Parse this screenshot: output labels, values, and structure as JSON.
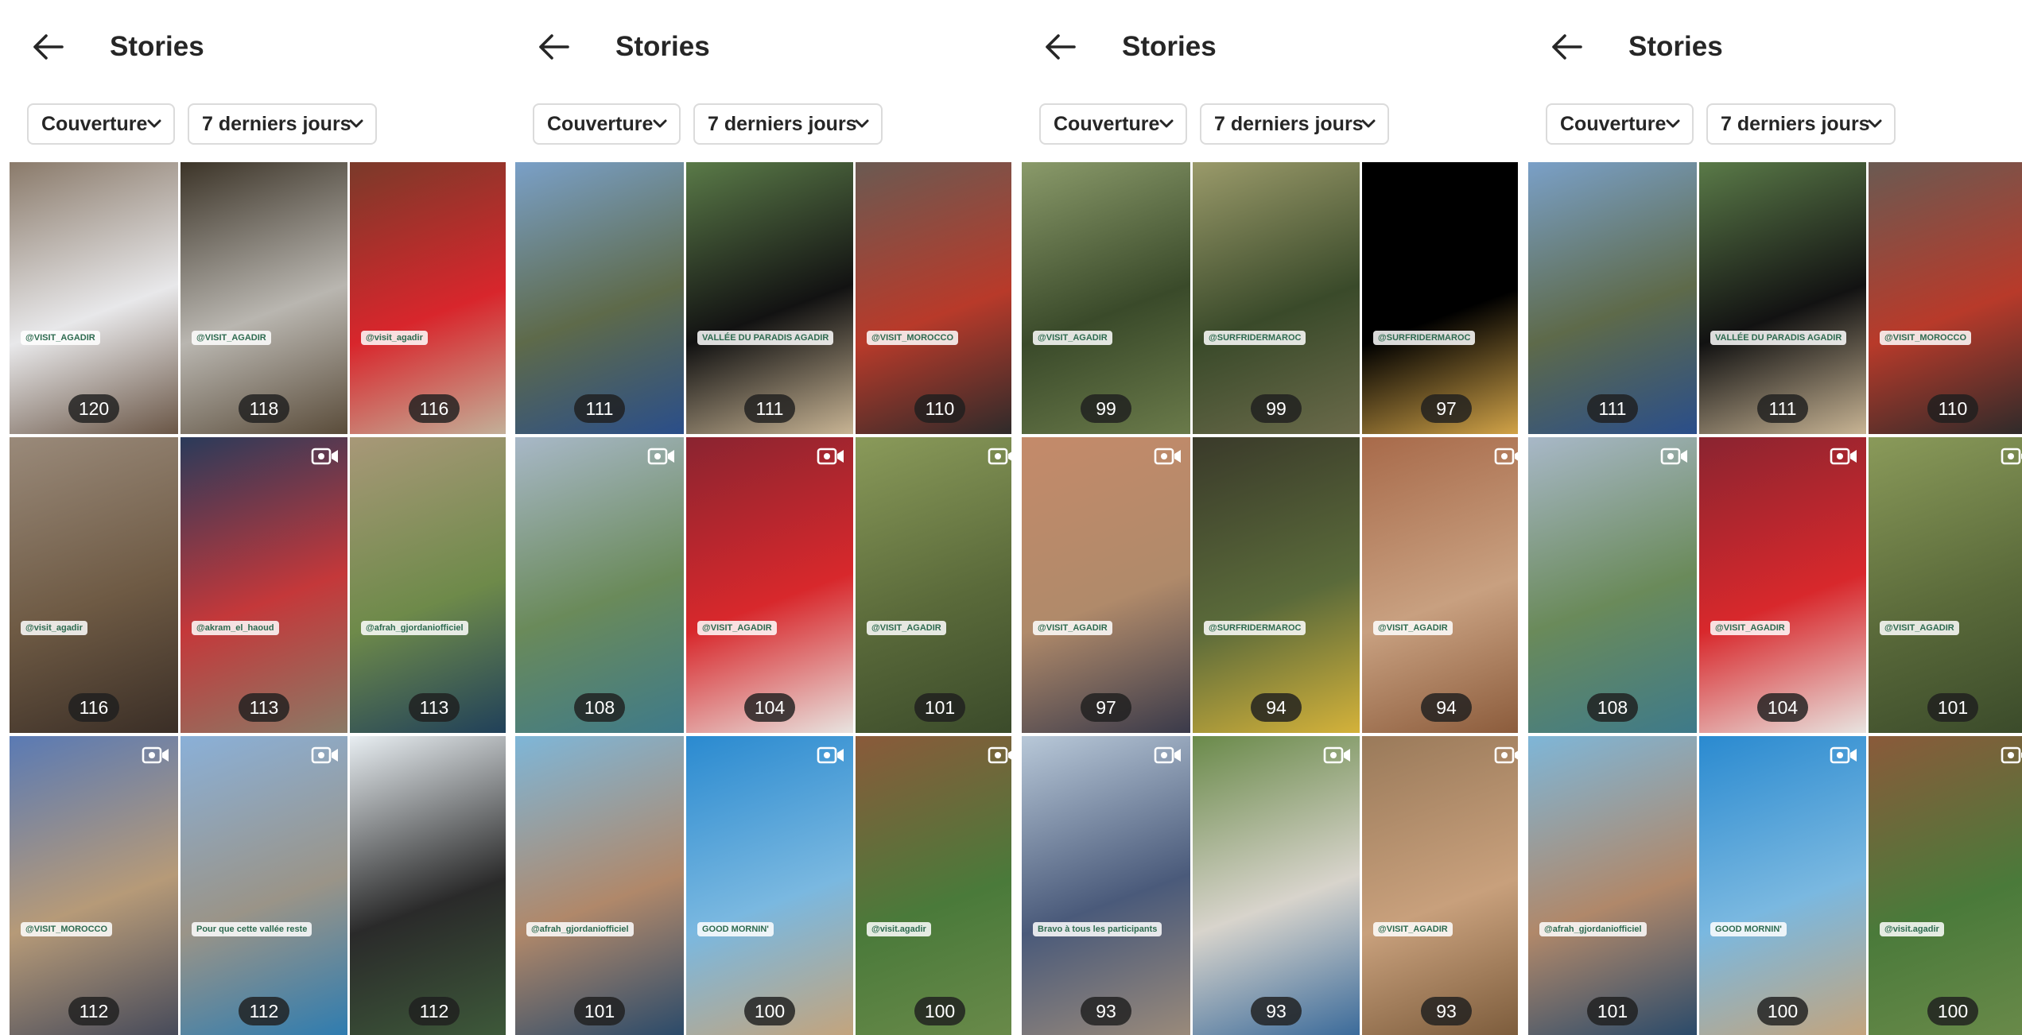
{
  "header": {
    "title": "Stories",
    "filters": [
      "Couverture",
      "7 derniers jours"
    ]
  },
  "panels": [
    {
      "tiles": [
        {
          "count": "120",
          "colors": [
            "#8a7a6a",
            "#e8e8ea",
            "#6a5646"
          ],
          "sticker": "@VISIT_AGADIR",
          "video": false
        },
        {
          "count": "118",
          "colors": [
            "#3c3428",
            "#b9b6b0",
            "#5a4c3a"
          ],
          "sticker": "@VISIT_AGADIR",
          "video": false
        },
        {
          "count": "116",
          "colors": [
            "#7a3a2a",
            "#d8262c",
            "#c2b49c"
          ],
          "sticker": "@visit_agadir",
          "video": false
        },
        {
          "count": "116",
          "colors": [
            "#9a8a7a",
            "#6e5a44",
            "#3a2e26"
          ],
          "sticker": "@visit_agadir",
          "video": false
        },
        {
          "count": "113",
          "colors": [
            "#2a3a5a",
            "#c4383a",
            "#8a7a66"
          ],
          "sticker": "@akram_el_haoud",
          "video": true
        },
        {
          "count": "113",
          "colors": [
            "#a89878",
            "#6e8a4a",
            "#1e3e5a"
          ],
          "sticker": "@afrah_gjordaniofficiel",
          "video": false
        },
        {
          "count": "112",
          "colors": [
            "#5a7ab4",
            "#b69a78",
            "#464a5a"
          ],
          "sticker": "@VISIT_MOROCCO",
          "video": true
        },
        {
          "count": "112",
          "colors": [
            "#8ab0d8",
            "#9a9488",
            "#2e7cb0"
          ],
          "sticker": "Pour que cette vallée reste",
          "video": true
        },
        {
          "count": "112",
          "colors": [
            "#e8eef2",
            "#2a2a2a",
            "#3e5a3a"
          ],
          "sticker": "",
          "video": false
        }
      ]
    },
    {
      "tiles": [
        {
          "count": "111",
          "colors": [
            "#7aa0c8",
            "#5e6a4a",
            "#2a4e8a"
          ],
          "sticker": "",
          "video": false
        },
        {
          "count": "111",
          "colors": [
            "#5a7a48",
            "#121212",
            "#c8b494"
          ],
          "sticker": "VALLÉE DU PARADIS AGADIR",
          "video": false
        },
        {
          "count": "110",
          "colors": [
            "#6a5a52",
            "#b83a2a",
            "#2a2a2a"
          ],
          "sticker": "@VISIT_MOROCCO",
          "video": false
        },
        {
          "count": "108",
          "colors": [
            "#a8b8c8",
            "#6a8a5a",
            "#3e7a8a"
          ],
          "sticker": "",
          "video": true
        },
        {
          "count": "104",
          "colors": [
            "#8a2430",
            "#d8282c",
            "#e8e4e0"
          ],
          "sticker": "@VISIT_AGADIR",
          "video": true
        },
        {
          "count": "101",
          "colors": [
            "#8a9a5a",
            "#5a6a3a",
            "#3a4a2a"
          ],
          "sticker": "@VISIT_AGADIR",
          "video": true
        },
        {
          "count": "101",
          "colors": [
            "#7eb6d8",
            "#b0886a",
            "#2a4a6a"
          ],
          "sticker": "@afrah_gjordaniofficiel",
          "video": false
        },
        {
          "count": "100",
          "colors": [
            "#2a8ad0",
            "#7ab8e0",
            "#c4a47c"
          ],
          "sticker": "GOOD MORNIN'",
          "video": true
        },
        {
          "count": "100",
          "colors": [
            "#8a5a3a",
            "#4a7a3a",
            "#6a8a4a"
          ],
          "sticker": "@visit.agadir",
          "video": true
        }
      ]
    },
    {
      "tiles": [
        {
          "count": "99",
          "colors": [
            "#8a9a6a",
            "#3a4a2a",
            "#6a7a4a"
          ],
          "sticker": "@VISIT_AGADIR",
          "video": false
        },
        {
          "count": "99",
          "colors": [
            "#9a9a6a",
            "#3a4a2a",
            "#6a6a4a"
          ],
          "sticker": "@SURFRIDERMAROC",
          "video": false
        },
        {
          "count": "97",
          "colors": [
            "#000000",
            "#000000",
            "#d8a84a"
          ],
          "sticker": "@SURFRIDERMAROC",
          "video": false
        },
        {
          "count": "97",
          "colors": [
            "#c48a6a",
            "#b08a6a",
            "#3a3a4a"
          ],
          "sticker": "@VISIT_AGADIR",
          "video": true
        },
        {
          "count": "94",
          "colors": [
            "#3a3a2a",
            "#5a6a3a",
            "#d4b23a"
          ],
          "sticker": "@SURFRIDERMAROC",
          "video": false
        },
        {
          "count": "94",
          "colors": [
            "#a86a4a",
            "#c8a080",
            "#8a5a3a"
          ],
          "sticker": "@VISIT_AGADIR",
          "video": true
        },
        {
          "count": "93",
          "colors": [
            "#b8c8d8",
            "#4a5a7a",
            "#9a8a7a"
          ],
          "sticker": "Bravo à tous les participants",
          "video": true
        },
        {
          "count": "93",
          "colors": [
            "#6a8a4a",
            "#d8d4cc",
            "#3a6a9a"
          ],
          "sticker": "",
          "video": true
        },
        {
          "count": "93",
          "colors": [
            "#9a7a5a",
            "#c8a07c",
            "#7a5a3a"
          ],
          "sticker": "@VISIT_AGADIR",
          "video": true
        }
      ]
    },
    {
      "tiles": [
        {
          "count": "111",
          "colors": [
            "#7aa0c8",
            "#5e6a4a",
            "#2a4e8a"
          ],
          "sticker": "",
          "video": false
        },
        {
          "count": "111",
          "colors": [
            "#5a7a48",
            "#121212",
            "#c8b494"
          ],
          "sticker": "VALLÉE DU PARADIS AGADIR",
          "video": false
        },
        {
          "count": "110",
          "colors": [
            "#6a5a52",
            "#b83a2a",
            "#2a2a2a"
          ],
          "sticker": "@VISIT_MOROCCO",
          "video": false
        },
        {
          "count": "108",
          "colors": [
            "#a8b8c8",
            "#6a8a5a",
            "#3e7a8a"
          ],
          "sticker": "",
          "video": true
        },
        {
          "count": "104",
          "colors": [
            "#8a2430",
            "#d8282c",
            "#e8e4e0"
          ],
          "sticker": "@VISIT_AGADIR",
          "video": true
        },
        {
          "count": "101",
          "colors": [
            "#8a9a5a",
            "#5a6a3a",
            "#3a4a2a"
          ],
          "sticker": "@VISIT_AGADIR",
          "video": true
        },
        {
          "count": "101",
          "colors": [
            "#7eb6d8",
            "#b0886a",
            "#2a4a6a"
          ],
          "sticker": "@afrah_gjordaniofficiel",
          "video": false
        },
        {
          "count": "100",
          "colors": [
            "#2a8ad0",
            "#7ab8e0",
            "#c4a47c"
          ],
          "sticker": "GOOD MORNIN'",
          "video": true
        },
        {
          "count": "100",
          "colors": [
            "#8a5a3a",
            "#4a7a3a",
            "#6a8a4a"
          ],
          "sticker": "@visit.agadir",
          "video": true
        }
      ]
    }
  ]
}
